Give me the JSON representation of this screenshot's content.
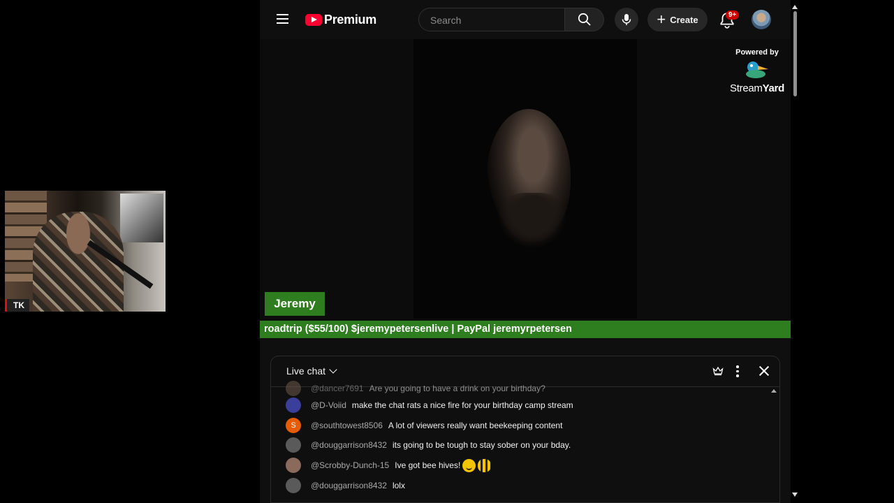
{
  "webcam": {
    "tag": "TK"
  },
  "header": {
    "brand": "Premium",
    "search_placeholder": "Search",
    "create_label": "Create",
    "notifications_badge": "9+"
  },
  "video": {
    "powered_by": "Powered by",
    "streamyard_a": "Stream",
    "streamyard_b": "Yard",
    "name_tag": "Jeremy",
    "ticker": "roadtrip ($55/100) $jeremypetersenlive | PayPal jeremyrpetersen"
  },
  "chat": {
    "title": "Live chat",
    "messages": [
      {
        "author": "@dancer7691",
        "text": "Are you going to have a drink on your birthday?",
        "avatar_color": "#6d5a4e",
        "initial": ""
      },
      {
        "author": "@D-Voiid",
        "text": "make the chat rats a nice fire for your birthday camp stream",
        "avatar_color": "#3b3f9c",
        "initial": ""
      },
      {
        "author": "@southtowest8506",
        "text": "A lot of viewers really want beekeeping content",
        "avatar_color": "#e65c00",
        "initial": "S"
      },
      {
        "author": "@douggarrison8432",
        "text": "its going to be tough to stay sober on your bday.",
        "avatar_color": "#5a5a5a",
        "initial": ""
      },
      {
        "author": "@Scrobby-Dunch-15",
        "text": "Ive got bee hives!",
        "avatar_color": "#8a6a5a",
        "initial": ""
      },
      {
        "author": "@douggarrison8432",
        "text": "lolx",
        "avatar_color": "#5a5a5a",
        "initial": ""
      }
    ]
  }
}
